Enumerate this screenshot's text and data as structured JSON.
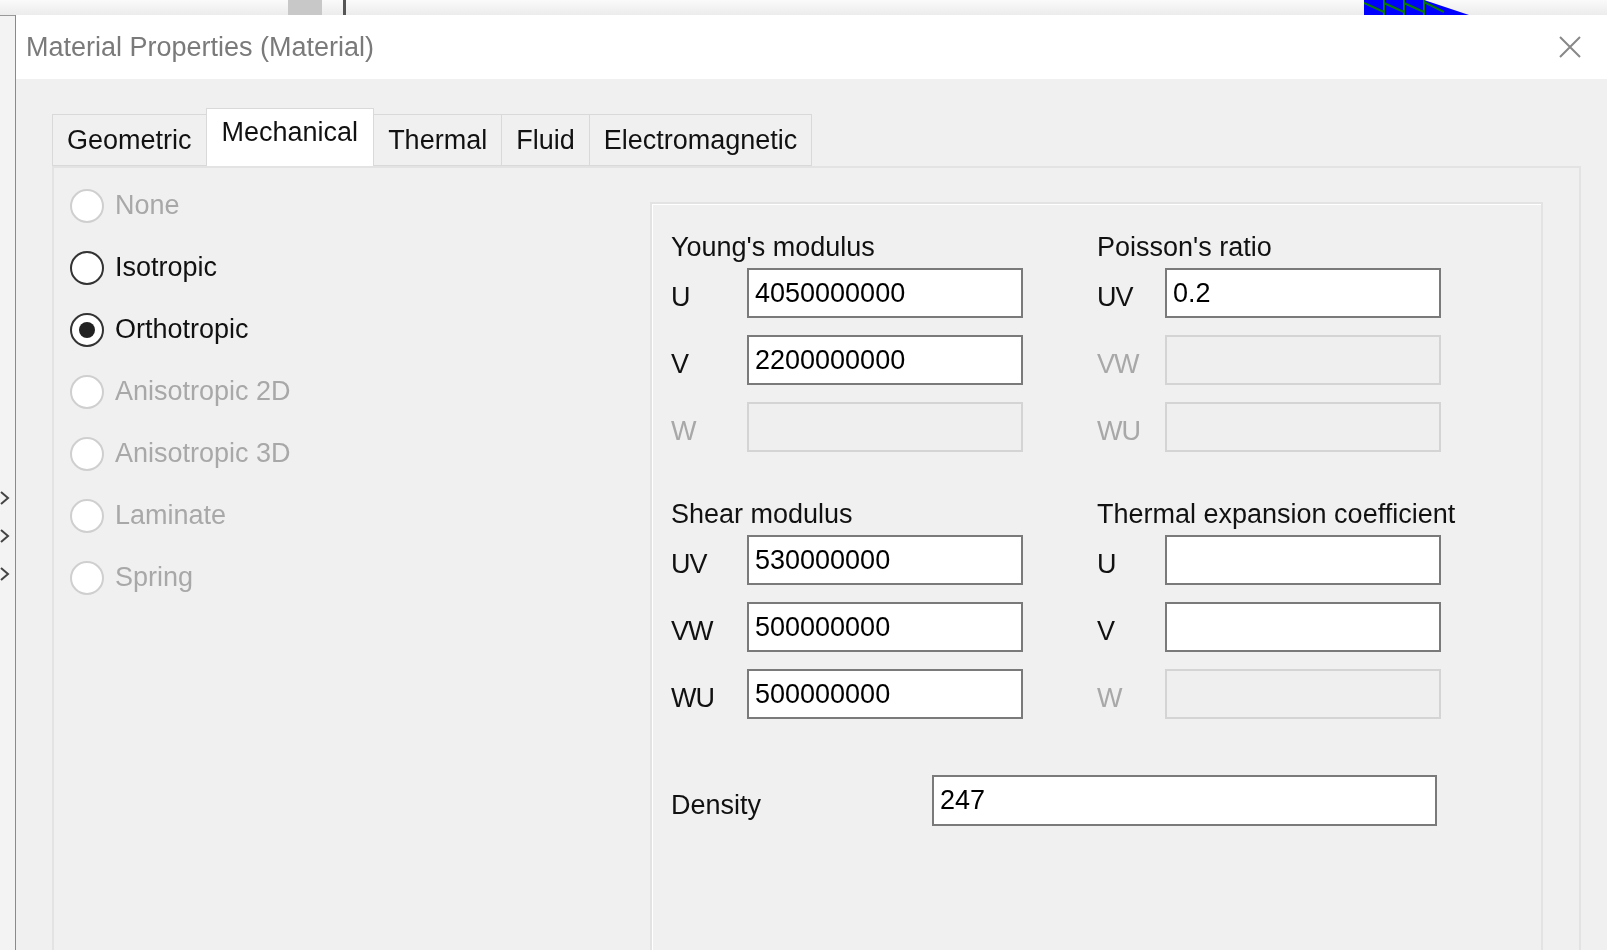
{
  "window": {
    "title": "Material Properties (Material)"
  },
  "tabs": [
    {
      "label": "Geometric",
      "selected": false
    },
    {
      "label": "Mechanical",
      "selected": true
    },
    {
      "label": "Thermal",
      "selected": false
    },
    {
      "label": "Fluid",
      "selected": false
    },
    {
      "label": "Electromagnetic",
      "selected": false
    }
  ],
  "material_types": [
    {
      "label": "None",
      "selected": false,
      "disabled": true
    },
    {
      "label": "Isotropic",
      "selected": false,
      "disabled": false
    },
    {
      "label": "Orthotropic",
      "selected": true,
      "disabled": false
    },
    {
      "label": "Anisotropic 2D",
      "selected": false,
      "disabled": true
    },
    {
      "label": "Anisotropic 3D",
      "selected": false,
      "disabled": true
    },
    {
      "label": "Laminate",
      "selected": false,
      "disabled": true
    },
    {
      "label": "Spring",
      "selected": false,
      "disabled": true
    }
  ],
  "sections": [
    {
      "title": "Young's modulus",
      "fields": [
        {
          "label": "U",
          "value": "4050000000",
          "disabled": false
        },
        {
          "label": "V",
          "value": "2200000000",
          "disabled": false
        },
        {
          "label": "W",
          "disabled": true
        }
      ]
    },
    {
      "title": "Poisson's ratio",
      "fields": [
        {
          "label": "UV",
          "value": "0.2",
          "disabled": false
        },
        {
          "label": "VW",
          "disabled": true
        },
        {
          "label": "WU",
          "disabled": true
        }
      ]
    },
    {
      "title": "Shear modulus",
      "fields": [
        {
          "label": "UV",
          "value": "530000000",
          "disabled": false
        },
        {
          "label": "VW",
          "value": "500000000",
          "disabled": false
        },
        {
          "label": "WU",
          "value": "500000000",
          "disabled": false
        }
      ]
    },
    {
      "title": "Thermal expansion coefficient",
      "fields": [
        {
          "label": "U",
          "disabled": false
        },
        {
          "label": "V",
          "disabled": false
        },
        {
          "label": "W",
          "disabled": true
        }
      ]
    }
  ],
  "density": {
    "label": "Density",
    "value": "247"
  }
}
